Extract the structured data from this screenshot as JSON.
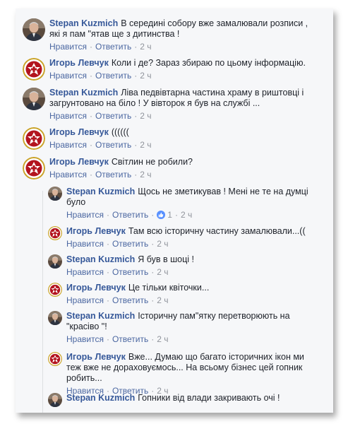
{
  "actions": {
    "like": "Нравится",
    "reply": "Ответить",
    "separator": "·"
  },
  "comments": [
    {
      "author": "Stepan Kuzmich",
      "avatar": "stepan-avatar",
      "text": "В середині собору вже замалювали розписи , які я пам \"ятав ще з дитинства !",
      "time": "2 ч"
    },
    {
      "author": "Игорь Левчук",
      "avatar": "emblem-avatar",
      "text": "Коли і де? Зараз збираю по цьому інформацію.",
      "time": "2 ч"
    },
    {
      "author": "Stepan Kuzmich",
      "avatar": "stepan-avatar",
      "text": "Ліва педвівтарна частина храму в риштовці і загрунтовано на біло ! У вівторок я був на службі ...",
      "time": "2 ч"
    },
    {
      "author": "Игорь Левчук",
      "avatar": "emblem-avatar",
      "text": "((((((",
      "time": "2 ч"
    },
    {
      "author": "Игорь Левчук",
      "avatar": "emblem-avatar",
      "text": "Світлин не робили?",
      "time": "2 ч"
    }
  ],
  "replies": [
    {
      "author": "Stepan Kuzmich",
      "avatar": "stepan-avatar",
      "text": "Щось не зметикував ! Мені не те на думці було",
      "time": "2 ч",
      "likes": "1"
    },
    {
      "author": "Игорь Левчук",
      "avatar": "emblem-avatar",
      "text": "Там всю історичну частину замалювали...((",
      "time": "2 ч"
    },
    {
      "author": "Stepan Kuzmich",
      "avatar": "stepan-avatar",
      "text": "Я був в шоці !",
      "time": "2 ч"
    },
    {
      "author": "Игорь Левчук",
      "avatar": "emblem-avatar",
      "text": "Це тільки квіточки...",
      "time": "2 ч"
    },
    {
      "author": "Stepan Kuzmich",
      "avatar": "stepan-avatar",
      "text": "Історичну пам\"ятку перетворюють на \"красіво \"!",
      "time": "2 ч"
    },
    {
      "author": "Игорь Левчук",
      "avatar": "emblem-avatar",
      "text": "Вже... Думаю що багато історичних ікон ми теж вже не дораховуємось... На всьому бізнес цей гопник робить...",
      "time": "2 ч"
    },
    {
      "author": "Stepan Kuzmich",
      "avatar": "stepan-avatar",
      "text": "Гопники від влади закривають очі !"
    }
  ]
}
